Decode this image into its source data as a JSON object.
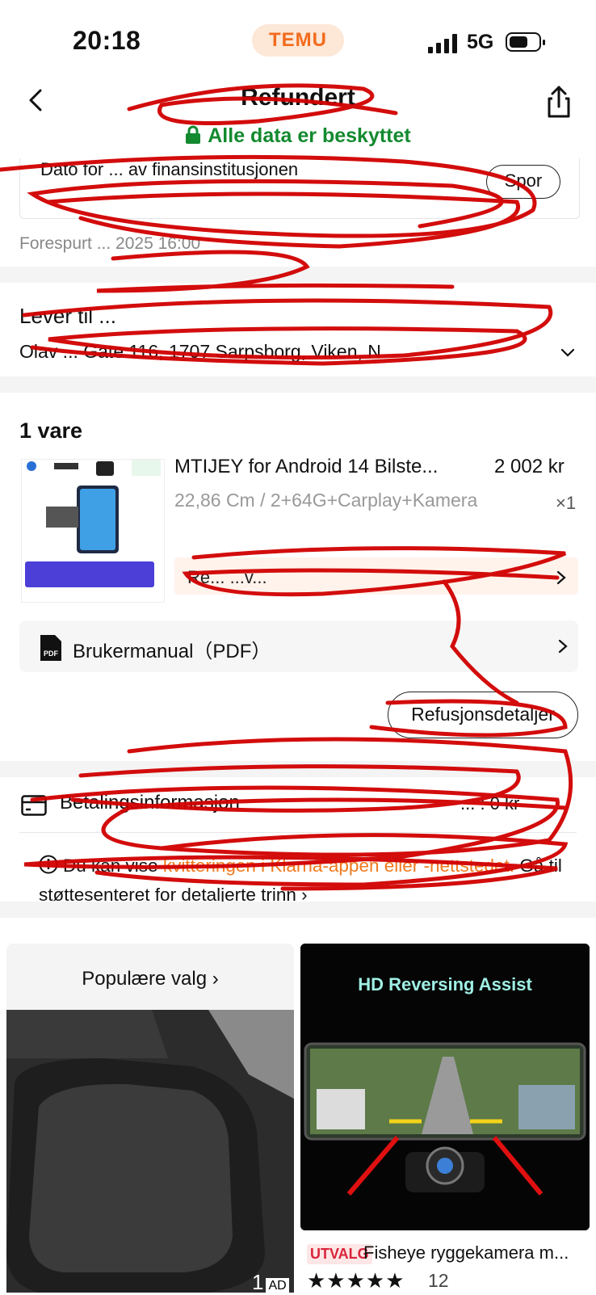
{
  "status_bar": {
    "time": "20:18",
    "app_badge": "TEMU",
    "network": "5G"
  },
  "header": {
    "title": "Refundert",
    "secure_text": "Alle data er beskyttet"
  },
  "status_card": {
    "text": "Dato for ... av finansinstitusjonen",
    "track_button": "Spor",
    "requested": "Forespurt ... 2025 16:00"
  },
  "delivery": {
    "label": "Lever til ...",
    "address": "Olav ... Gate 116, 1707 Sarpsborg, Viken, N"
  },
  "items": {
    "count_label": "1 vare",
    "product": {
      "name": "MTIJEY for Android 14 Bilste...",
      "price": "2 002 kr",
      "variant": "22,86 Cm / 2+64G+Carplay+Kamera",
      "qty": "×1",
      "refund_banner": "Re... ...v..."
    },
    "manual_label": "Brukermanual（PDF）",
    "refund_details_button": "Refusjonsdetaljer"
  },
  "payment": {
    "label": "Betalingsinformasjon",
    "right": "... : 0 kr"
  },
  "info": {
    "prefix": "Du kan vise ",
    "orange": "kvitteringen i Klarna-appen eller -nettstedet.",
    "suffix": " Gå til støttesenteret for detaljerte trinn"
  },
  "recommendations": {
    "left": {
      "title": "Populære valg",
      "ad_text": "1",
      "ad_badge": "AD"
    },
    "right": {
      "banner": "HD Reversing Assist",
      "tag": "UTVALG",
      "name": "Fisheye ryggekamera m...",
      "stars": "★★★★★",
      "rating_count": "12"
    }
  },
  "colors": {
    "accent": "#f26b1d",
    "secure_green": "#138a2f",
    "scribble": "#d10000"
  }
}
